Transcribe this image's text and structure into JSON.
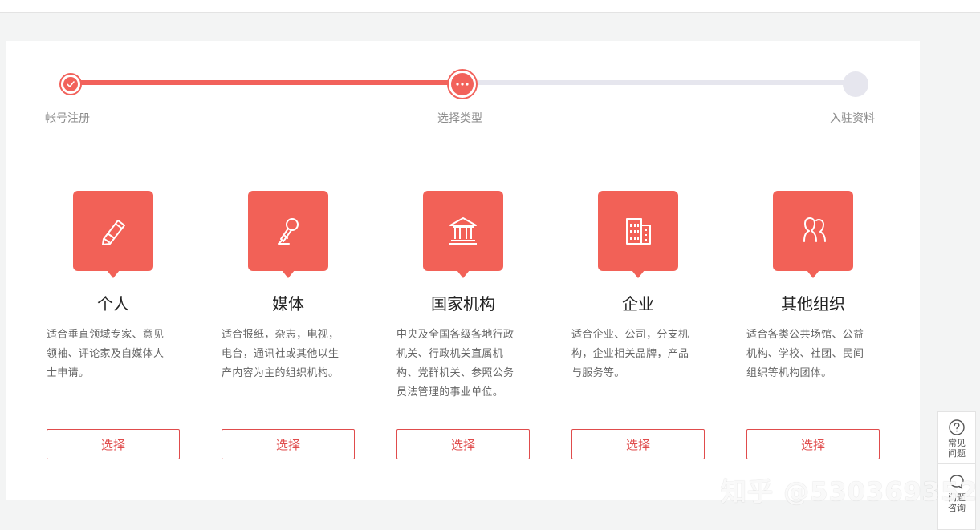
{
  "stepper": {
    "steps": [
      {
        "label": "帐号注册",
        "state": "done"
      },
      {
        "label": "选择类型",
        "state": "current"
      },
      {
        "label": "入驻资料",
        "state": "pending"
      }
    ],
    "accent_color": "#f2625b",
    "pending_color": "#e6e6ee"
  },
  "types": [
    {
      "icon": "pencil-icon",
      "title": "个人",
      "desc": [
        "适合垂直领域专家、意见",
        "领袖、评论家及自媒体人",
        "士申请。"
      ],
      "button": "选择"
    },
    {
      "icon": "microphone-icon",
      "title": "媒体",
      "desc": [
        "适合报纸，杂志，电视，",
        "电台，通讯社或其他以生",
        "产内容为主的组织机构。"
      ],
      "button": "选择"
    },
    {
      "icon": "government-building-icon",
      "title": "国家机构",
      "desc": [
        "中央及全国各级各地行政",
        "机关、行政机关直属机",
        "构、党群机关、参照公务",
        "员法管理的事业单位。"
      ],
      "button": "选择"
    },
    {
      "icon": "office-building-icon",
      "title": "企业",
      "desc": [
        "适合企业、公司，分支机",
        "构，企业相关品牌，产品",
        "与服务等。"
      ],
      "button": "选择"
    },
    {
      "icon": "group-people-icon",
      "title": "其他组织",
      "desc": [
        "适合各类公共场馆、公益",
        "机构、学校、社团、民间",
        "组织等机构团体。"
      ],
      "button": "选择"
    }
  ],
  "side_widget": {
    "faq": {
      "icon": "question-icon",
      "label": "常见问题"
    },
    "consult": {
      "icon": "chat-bubble-icon",
      "label": "问题咨询"
    }
  },
  "watermark": "知乎 @530369352"
}
